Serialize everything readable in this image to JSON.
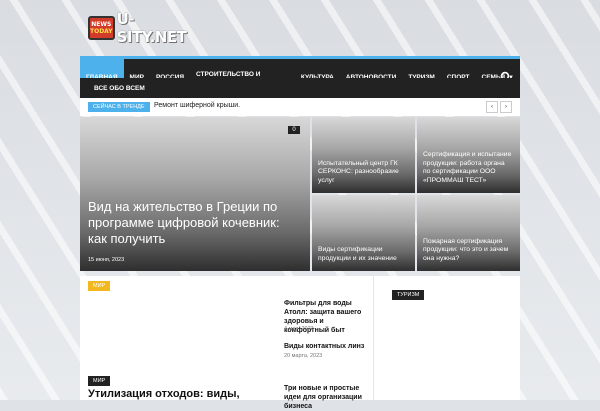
{
  "logo": {
    "tv_top": "NEWS",
    "tv_bottom": "TODAY",
    "name": "U-SITY.NET"
  },
  "menu": {
    "items": [
      "ГЛАВНАЯ",
      "МИР",
      "РОССИЯ",
      "СТРОИТЕЛЬСТВО И НЕДВИЖИМОСТЬ",
      "КУЛЬТУРА",
      "АВТОНОВОСТИ",
      "ТУРИЗМ",
      "СПОРТ",
      "СЕМЬЯ"
    ],
    "second_row": "ВСЕ ОБО ВСЕМ"
  },
  "ticker": {
    "badge": "СЕЙЧАС В ТРЕНДЕ",
    "text": "Ремонт шиферной крыши."
  },
  "featured": {
    "big": {
      "title": "Вид на жительство в Греции по программе цифровой кочевник: как получить",
      "date": "15 июня, 2023",
      "comments": "0"
    },
    "small": [
      {
        "title": "Испытательный центр ГК СЕРКОНС: разнообразие услуг"
      },
      {
        "title": "Сертификация и испытание продукции: работа органа по сертификации ООО «ПРОММАШ ТЕСТ»"
      },
      {
        "title": "Виды сертификации продукции и их значение"
      },
      {
        "title": "Пожарная сертификация продукции: что это и зачем она нужна?"
      }
    ]
  },
  "content": {
    "block1_cat": "МИР",
    "posts": [
      {
        "title": "Фильтры для воды Атолл: защита вашего здоровья и комфортный быт",
        "date": "4 мая, 2023"
      },
      {
        "title": "Виды контактных линз",
        "date": "20 марта, 2023"
      },
      {
        "title": "Три новые и простые идеи для организации бизнеса"
      }
    ],
    "block2_cat": "МИР",
    "block2_title": "Утилизация отходов: виды,",
    "right_cat": "ТУРИЗМ"
  },
  "colors": {
    "accent": "#4db2ec",
    "menu_bg": "#222222",
    "category_yellow": "#f2b81e"
  }
}
